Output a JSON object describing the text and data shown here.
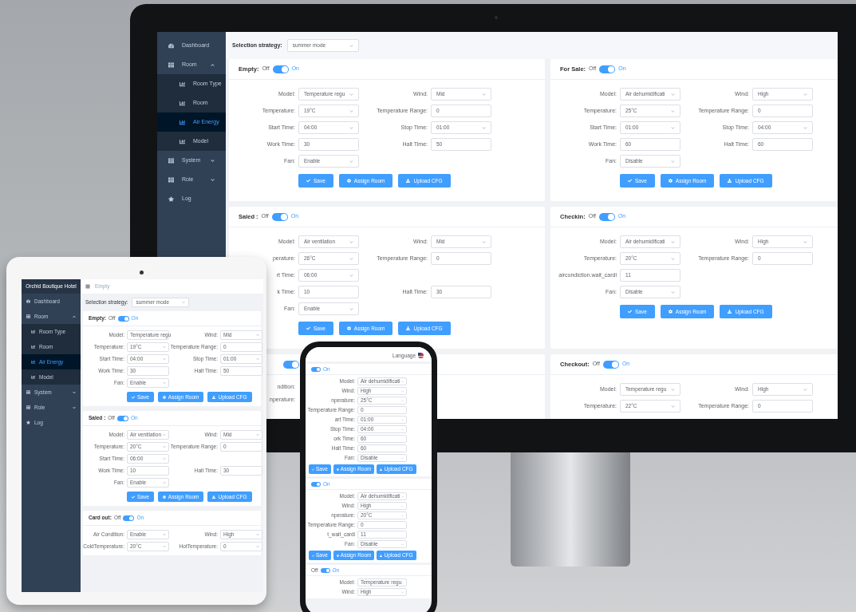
{
  "monitor": {
    "sidebar": [
      {
        "label": "Dashboard",
        "kind": "dashboard",
        "selected": false
      },
      {
        "label": "Room",
        "kind": "group",
        "selected": false,
        "expanded": true,
        "children": [
          {
            "label": "Room Type",
            "kind": "chart",
            "selected": false
          },
          {
            "label": "Room",
            "kind": "chart",
            "selected": false
          },
          {
            "label": "Air Energy",
            "kind": "chart",
            "selected": true
          },
          {
            "label": "Model",
            "kind": "chart",
            "selected": false
          }
        ]
      },
      {
        "label": "System",
        "kind": "group",
        "selected": false,
        "expanded": false
      },
      {
        "label": "Role",
        "kind": "group",
        "selected": false,
        "expanded": false
      },
      {
        "label": "Log",
        "kind": "log",
        "selected": false
      }
    ],
    "strategy": {
      "label": "Selection strategy:",
      "value": "summer mode"
    },
    "cards": [
      {
        "title": "Empty:",
        "off_label": "Off",
        "on_label": "On",
        "on": true,
        "rows": [
          [
            {
              "label": "Model:",
              "value": "Temperature regu",
              "kind": "select"
            },
            {
              "label": "Wind:",
              "value": "Mid",
              "kind": "select"
            }
          ],
          [
            {
              "label": "Temperature:",
              "value": "19°C",
              "kind": "select"
            },
            {
              "label": "Temperature Range:",
              "value": "0",
              "kind": "input"
            }
          ],
          [
            {
              "label": "Start Time:",
              "value": "04:00",
              "kind": "select"
            },
            {
              "label": "Stop Time:",
              "value": "01:00",
              "kind": "select"
            }
          ],
          [
            {
              "label": "Work Time:",
              "value": "30",
              "kind": "input"
            },
            {
              "label": "Halt Time:",
              "value": "50",
              "kind": "input"
            }
          ],
          [
            {
              "label": "Fan:",
              "value": "Enable",
              "kind": "select"
            }
          ]
        ],
        "buttons": [
          {
            "label": "Save",
            "kind": "save"
          },
          {
            "label": "Assign Room",
            "kind": "assign"
          },
          {
            "label": "Upload CFG",
            "kind": "upload"
          }
        ]
      },
      {
        "title": "For Sale:",
        "off_label": "Off",
        "on_label": "On",
        "on": true,
        "rows": [
          [
            {
              "label": "Model:",
              "value": "Air dehumidificati",
              "kind": "select"
            },
            {
              "label": "Wind:",
              "value": "High",
              "kind": "select"
            }
          ],
          [
            {
              "label": "Temperature:",
              "value": "25°C",
              "kind": "select"
            },
            {
              "label": "Temperature Range:",
              "value": "0",
              "kind": "input"
            }
          ],
          [
            {
              "label": "Start Time:",
              "value": "01:00",
              "kind": "select"
            },
            {
              "label": "Stop Time:",
              "value": "04:00",
              "kind": "select"
            }
          ],
          [
            {
              "label": "Work Time:",
              "value": "60",
              "kind": "input"
            },
            {
              "label": "Halt Time:",
              "value": "60",
              "kind": "input"
            }
          ],
          [
            {
              "label": "Fan:",
              "value": "Disable",
              "kind": "select"
            }
          ]
        ],
        "buttons": [
          {
            "label": "Save",
            "kind": "save"
          },
          {
            "label": "Assign Room",
            "kind": "assign"
          },
          {
            "label": "Upload CFG",
            "kind": "upload"
          }
        ]
      },
      {
        "title": "Saled :",
        "off_label": "Off",
        "on_label": "On",
        "on": true,
        "rows": [
          [
            {
              "label": "Model:",
              "value": "Air ventilation",
              "kind": "select"
            },
            {
              "label": "Wind:",
              "value": "Mid",
              "kind": "select"
            }
          ],
          [
            {
              "label": "perature:",
              "value": "26°C",
              "kind": "select"
            },
            {
              "label": "Temperature Range:",
              "value": "0",
              "kind": "input"
            }
          ],
          [
            {
              "label": "rt Time:",
              "value": "06:00",
              "kind": "select"
            }
          ],
          [
            {
              "label": "k Time:",
              "value": "10",
              "kind": "input"
            },
            {
              "label": "Halt Time:",
              "value": "30",
              "kind": "input"
            }
          ],
          [
            {
              "label": "Fan:",
              "value": "Enable",
              "kind": "select"
            }
          ]
        ],
        "buttons": [
          {
            "label": "Save",
            "kind": "save"
          },
          {
            "label": "Assign Room",
            "kind": "assign"
          },
          {
            "label": "Upload CFG",
            "kind": "upload"
          }
        ]
      },
      {
        "title": "Checkin:",
        "off_label": "Off",
        "on_label": "On",
        "on": true,
        "rows": [
          [
            {
              "label": "Model:",
              "value": "Air dehumidificati",
              "kind": "select"
            },
            {
              "label": "Wind:",
              "value": "High",
              "kind": "select"
            }
          ],
          [
            {
              "label": "Temperature:",
              "value": "20°C",
              "kind": "select"
            },
            {
              "label": "Temperature Range:",
              "value": "0",
              "kind": "input"
            }
          ],
          [
            {
              "label": "aircondiction.wait_cardi",
              "value": "11",
              "kind": "input"
            }
          ],
          [
            {
              "label": "Fan:",
              "value": "Disable",
              "kind": "select"
            }
          ]
        ],
        "buttons": [
          {
            "label": "Save",
            "kind": "save"
          },
          {
            "label": "Assign Room",
            "kind": "assign"
          },
          {
            "label": "Upload CFG",
            "kind": "upload"
          }
        ]
      },
      {
        "on": true,
        "rows": [
          [
            {
              "label": "ndition:"
            }
          ],
          [
            {
              "label": "nperature:"
            }
          ]
        ]
      },
      {
        "title": "Checkout:",
        "off_label": "Off",
        "on_label": "On",
        "on": true,
        "rows": [
          [
            {
              "label": "Model:",
              "value": "Temperature regu",
              "kind": "select"
            },
            {
              "label": "Wind:",
              "value": "High",
              "kind": "select"
            }
          ],
          [
            {
              "label": "Temperature:",
              "value": "22°C",
              "kind": "select"
            },
            {
              "label": "Temperature Range:",
              "value": "0",
              "kind": "input"
            }
          ]
        ]
      }
    ]
  },
  "tablet": {
    "brand": "Orchid Boutique Hotel",
    "breadcrumb": "Empty",
    "sidebar": [
      {
        "label": "Dashboard",
        "kind": "dashboard",
        "selected": false
      },
      {
        "label": "Room",
        "kind": "group",
        "selected": false,
        "expanded": true,
        "children": [
          {
            "label": "Room Type",
            "kind": "chart",
            "selected": false
          },
          {
            "label": "Room",
            "kind": "chart",
            "selected": false
          },
          {
            "label": "Air Energy",
            "kind": "chart",
            "selected": true
          },
          {
            "label": "Model",
            "kind": "chart",
            "selected": false
          }
        ]
      },
      {
        "label": "System",
        "kind": "group",
        "selected": false,
        "expanded": false
      },
      {
        "label": "Role",
        "kind": "group",
        "selected": false,
        "expanded": false
      },
      {
        "label": "Log",
        "kind": "log",
        "selected": false
      }
    ],
    "strategy": {
      "label": "Selection strategy:",
      "value": "summer mode"
    },
    "cards": [
      {
        "title": "Empty:",
        "off_label": "Off",
        "on_label": "On",
        "on": true,
        "rows": [
          [
            {
              "label": "Model:",
              "value": "Temperature regu",
              "kind": "select"
            },
            {
              "label": "Wind:",
              "value": "Mid",
              "kind": "select"
            }
          ],
          [
            {
              "label": "Temperature:",
              "value": "19°C",
              "kind": "select"
            },
            {
              "label": "Temperature Range:",
              "value": "0",
              "kind": "input"
            }
          ],
          [
            {
              "label": "Start Time:",
              "value": "04:00",
              "kind": "select"
            },
            {
              "label": "Stop Time:",
              "value": "01:00",
              "kind": "select"
            }
          ],
          [
            {
              "label": "Work Time:",
              "value": "30",
              "kind": "input"
            },
            {
              "label": "Halt Time:",
              "value": "50",
              "kind": "input"
            }
          ],
          [
            {
              "label": "Fan:",
              "value": "Enable",
              "kind": "select"
            }
          ]
        ],
        "buttons": [
          {
            "label": "Save",
            "kind": "save"
          },
          {
            "label": "Assign Room",
            "kind": "assign"
          },
          {
            "label": "Upload CFG",
            "kind": "upload"
          }
        ]
      },
      {
        "title": "Saled :",
        "off_label": "Off",
        "on_label": "On",
        "on": true,
        "rows": [
          [
            {
              "label": "Model:",
              "value": "Air ventilation",
              "kind": "select"
            },
            {
              "label": "Wind:",
              "value": "Mid",
              "kind": "select"
            }
          ],
          [
            {
              "label": "Temperature:",
              "value": "20°C",
              "kind": "select"
            },
            {
              "label": "Temperature Range:",
              "value": "0",
              "kind": "input"
            }
          ],
          [
            {
              "label": "Start Time:",
              "value": "06:00",
              "kind": "select"
            }
          ],
          [
            {
              "label": "Work Time:",
              "value": "10",
              "kind": "input"
            },
            {
              "label": "Halt Time:",
              "value": "30",
              "kind": "input"
            }
          ],
          [
            {
              "label": "Fan:",
              "value": "Enable",
              "kind": "select"
            }
          ]
        ],
        "buttons": [
          {
            "label": "Save",
            "kind": "save"
          },
          {
            "label": "Assign Room",
            "kind": "assign"
          },
          {
            "label": "Upload CFG",
            "kind": "upload"
          }
        ]
      },
      {
        "title": "Card out:",
        "off_label": "Off",
        "on_label": "On",
        "on": true,
        "rows": [
          [
            {
              "label": "Air Condition:",
              "value": "Enable",
              "kind": "select"
            },
            {
              "label": "Wind:",
              "value": "High",
              "kind": "select"
            }
          ],
          [
            {
              "label": "ColdTemperature:",
              "value": "20°C",
              "kind": "select"
            },
            {
              "label": "HotTemperature:",
              "value": "0",
              "kind": "select"
            }
          ]
        ]
      }
    ]
  },
  "phone": {
    "language": "Language",
    "cards": [
      {
        "on_label": "On",
        "on": true,
        "rows": [
          [
            {
              "label": "Model:",
              "value": "Air dehumidificati",
              "kind": "select"
            },
            {
              "label": "Wind:",
              "value": "High",
              "kind": "select"
            }
          ],
          [
            {
              "label": "nperature:",
              "value": "25°C",
              "kind": "select"
            },
            {
              "label": "Temperature Range:",
              "value": "0",
              "kind": "input"
            }
          ],
          [
            {
              "label": "art Time:",
              "value": "01:00",
              "kind": "select"
            },
            {
              "label": "Stop Time:",
              "value": "04:00",
              "kind": "select"
            }
          ],
          [
            {
              "label": "ork Time:",
              "value": "60",
              "kind": "input"
            },
            {
              "label": "Halt Time:",
              "value": "60",
              "kind": "input"
            }
          ],
          [
            {
              "label": "Fan:",
              "value": "Disable",
              "kind": "select"
            }
          ]
        ],
        "buttons": [
          {
            "label": "Save",
            "kind": "save"
          },
          {
            "label": "Assign Room",
            "kind": "assign"
          },
          {
            "label": "Upload CFG",
            "kind": "upload"
          }
        ]
      },
      {
        "on_label": "On",
        "on": true,
        "rows": [
          [
            {
              "label": "Model:",
              "value": "Air dehumidificati",
              "kind": "select"
            },
            {
              "label": "Wind:",
              "value": "High",
              "kind": "select"
            }
          ],
          [
            {
              "label": "nperature:",
              "value": "20°C",
              "kind": "select"
            },
            {
              "label": "Temperature Range:",
              "value": "0",
              "kind": "input"
            }
          ],
          [
            {
              "label": "t_wait_cardi",
              "value": "11",
              "kind": "input"
            }
          ],
          [
            {
              "label": "Fan:",
              "value": "Disable",
              "kind": "select"
            }
          ]
        ],
        "buttons": [
          {
            "label": "Save",
            "kind": "save"
          },
          {
            "label": "Assign Room",
            "kind": "assign"
          },
          {
            "label": "Upload CFG",
            "kind": "upload"
          }
        ]
      },
      {
        "off_label": "Off",
        "on_label": "On",
        "on": true,
        "rows": [
          [
            {
              "label": "Model:",
              "value": "Temperature regu",
              "kind": "select"
            },
            {
              "label": "Wind:",
              "value": "High",
              "kind": "select"
            }
          ]
        ]
      }
    ]
  }
}
